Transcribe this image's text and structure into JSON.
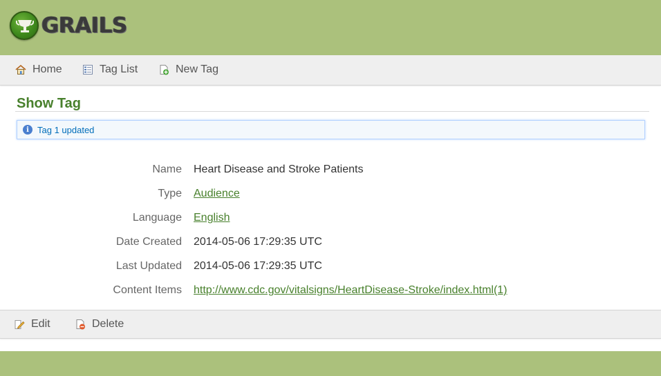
{
  "header": {
    "logo_text": "GRAILS"
  },
  "nav": {
    "items": [
      {
        "label": "Home",
        "icon": "home-icon"
      },
      {
        "label": "Tag List",
        "icon": "list-icon"
      },
      {
        "label": "New Tag",
        "icon": "new-icon"
      }
    ]
  },
  "page": {
    "title": "Show Tag"
  },
  "message": {
    "text": "Tag 1 updated",
    "icon": "info-icon"
  },
  "fields": [
    {
      "label": "Name",
      "value": "Heart Disease and Stroke Patients"
    },
    {
      "label": "Type",
      "value": "Audience"
    },
    {
      "label": "Language",
      "value": "English"
    },
    {
      "label": "Date Created",
      "value": "2014-05-06 17:29:35 UTC"
    },
    {
      "label": "Last Updated",
      "value": "2014-05-06 17:29:35 UTC"
    },
    {
      "label": "Content Items",
      "value": "http://www.cdc.gov/vitalsigns/HeartDisease-Stroke/index.html(1)"
    }
  ],
  "buttons": {
    "edit_label": "Edit",
    "delete_label": "Delete"
  },
  "colors": {
    "header_bg": "#abc17c",
    "link": "#48802c",
    "message_text": "#006dba"
  }
}
